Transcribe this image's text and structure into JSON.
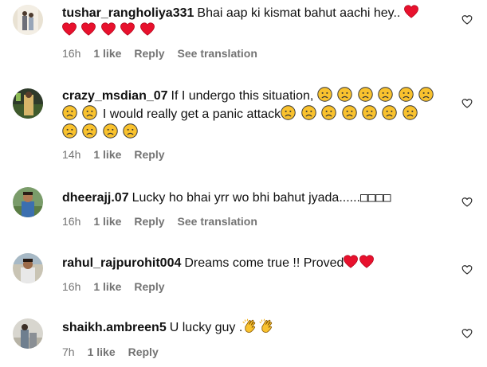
{
  "comments": [
    {
      "username": "tushar_rangholiya331",
      "text": "Bhai aap ki kismat bahut aachi hey..",
      "time": "16h",
      "likes": "1 like",
      "reply": "Reply",
      "translation": "See translation"
    },
    {
      "username": "crazy_msdian_07",
      "text1": "If I undergo this situation,",
      "text2": "I would really get a panic attack",
      "time": "14h",
      "likes": "1 like",
      "reply": "Reply"
    },
    {
      "username": "dheerajj.07",
      "text": "Lucky ho bhai yrr wo bhi bahut jyada......",
      "boxes": "□□□□",
      "time": "16h",
      "likes": "1 like",
      "reply": "Reply",
      "translation": "See translation"
    },
    {
      "username": "rahul_rajpurohit004",
      "text": "Dreams come true !! Proved",
      "time": "16h",
      "likes": "1 like",
      "reply": "Reply"
    },
    {
      "username": "shaikh.ambreen5",
      "text": "U lucky guy .",
      "time": "7h",
      "likes": "1 like",
      "reply": "Reply"
    }
  ],
  "colors": {
    "meta": "#737373",
    "heart": "#ff0033",
    "emoji": "#f9c22e"
  },
  "icons": [
    "heart-outline-icon",
    "red-heart-emoji",
    "worried-face-emoji",
    "clapping-hands-emoji"
  ]
}
